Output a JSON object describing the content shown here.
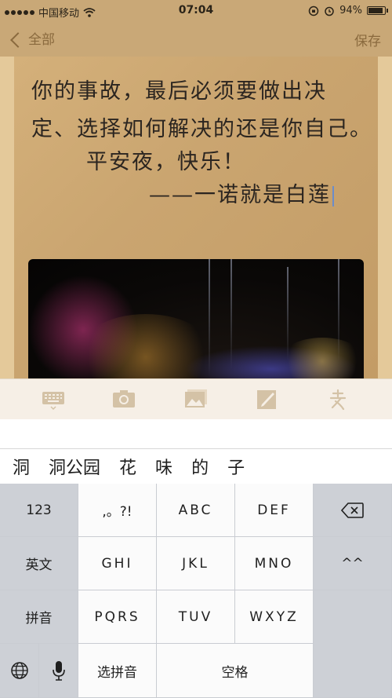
{
  "status_bar": {
    "carrier": "中国移动",
    "time": "07:04",
    "battery": "94%",
    "battery_level": 0.94,
    "icons": [
      "signal-dots-icon",
      "wifi-icon",
      "orientation-lock-icon",
      "alarm-icon",
      "battery-icon"
    ]
  },
  "nav": {
    "back_label": "全部",
    "save_label": "保存"
  },
  "note": {
    "line1": "你的事故，最后必须要做出决",
    "line2": "定、选择如何解决的还是你自己。",
    "line3": "平安夜，快乐！",
    "line4": "——一诺就是白莲"
  },
  "toolbar": {
    "icons": [
      "keyboard-icon",
      "camera-icon",
      "photo-icon",
      "sketch-icon",
      "handwriting-icon"
    ]
  },
  "candidates": [
    "洞",
    "洞公园",
    "花",
    "味",
    "的",
    "子"
  ],
  "keyboard": {
    "row1": [
      "123",
      ",。?!",
      "ABC",
      "DEF"
    ],
    "row2": [
      "英文",
      "GHI",
      "JKL",
      "MNO",
      "^^"
    ],
    "row3": [
      "拼音",
      "PQRS",
      "TUV",
      "WXYZ"
    ],
    "row4_select": "选拼音",
    "row4_space": "空格",
    "icons": [
      "delete-icon",
      "globe-icon",
      "microphone-icon"
    ]
  },
  "colors": {
    "header": "#c9a877",
    "accent": "#8a6a3e",
    "key_light": "#fbfbfb",
    "key_dark": "#cdd0d6"
  }
}
